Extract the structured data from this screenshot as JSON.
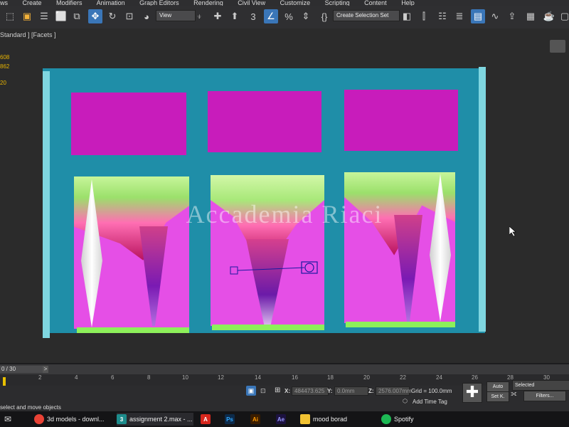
{
  "menu": [
    "ws",
    "Create",
    "Modifiers",
    "Animation",
    "Graph Editors",
    "Rendering",
    "Civil View",
    "Customize",
    "Scripting",
    "Content",
    "Help"
  ],
  "toolbar": {
    "view_dropdown": "View",
    "selection_set": "Create Selection Set",
    "snap_label": "3"
  },
  "viewport": {
    "label": "Standard ] [Facets ]",
    "stats": [
      "608",
      "862",
      "20"
    ]
  },
  "watermark": "Accademia Riaci",
  "timeline": {
    "frame": "0 / 30",
    "next": ">",
    "ticks": [
      "2",
      "4",
      "6",
      "8",
      "10",
      "12",
      "14",
      "16",
      "18",
      "20",
      "22",
      "24",
      "26",
      "28",
      "30"
    ]
  },
  "status": {
    "x_label": "X:",
    "x_value": "484473.625",
    "y_label": "Y:",
    "y_value": "0.0mm",
    "z_label": "Z:",
    "z_value": "2576.007mm",
    "grid": "Grid = 100.0mm",
    "add_time_tag": "Add Time Tag",
    "prompt": "select and move objects",
    "auto": "Auto",
    "set_key": "Set K.",
    "selected": "Selected",
    "filters": "Filters..."
  },
  "taskbar": [
    {
      "label": "3d models - downl...",
      "icon": "chrome-icon",
      "color": "#e94235"
    },
    {
      "label": "assignment 2.max - ...",
      "icon": "3dsmax-icon",
      "color": "#1d8c8c"
    },
    {
      "label": "",
      "icon": "acrobat-icon",
      "color": "#d7271d"
    },
    {
      "label": "",
      "icon": "photoshop-icon",
      "color": "#0c2a4a"
    },
    {
      "label": "",
      "icon": "illustrator-icon",
      "color": "#3a1d00"
    },
    {
      "label": "",
      "icon": "after-effects-icon",
      "color": "#1c1240"
    },
    {
      "label": "mood borad",
      "icon": "folder-icon",
      "color": "#f1c232"
    },
    {
      "label": "Spotify",
      "icon": "spotify-icon",
      "color": "#1db954"
    }
  ]
}
